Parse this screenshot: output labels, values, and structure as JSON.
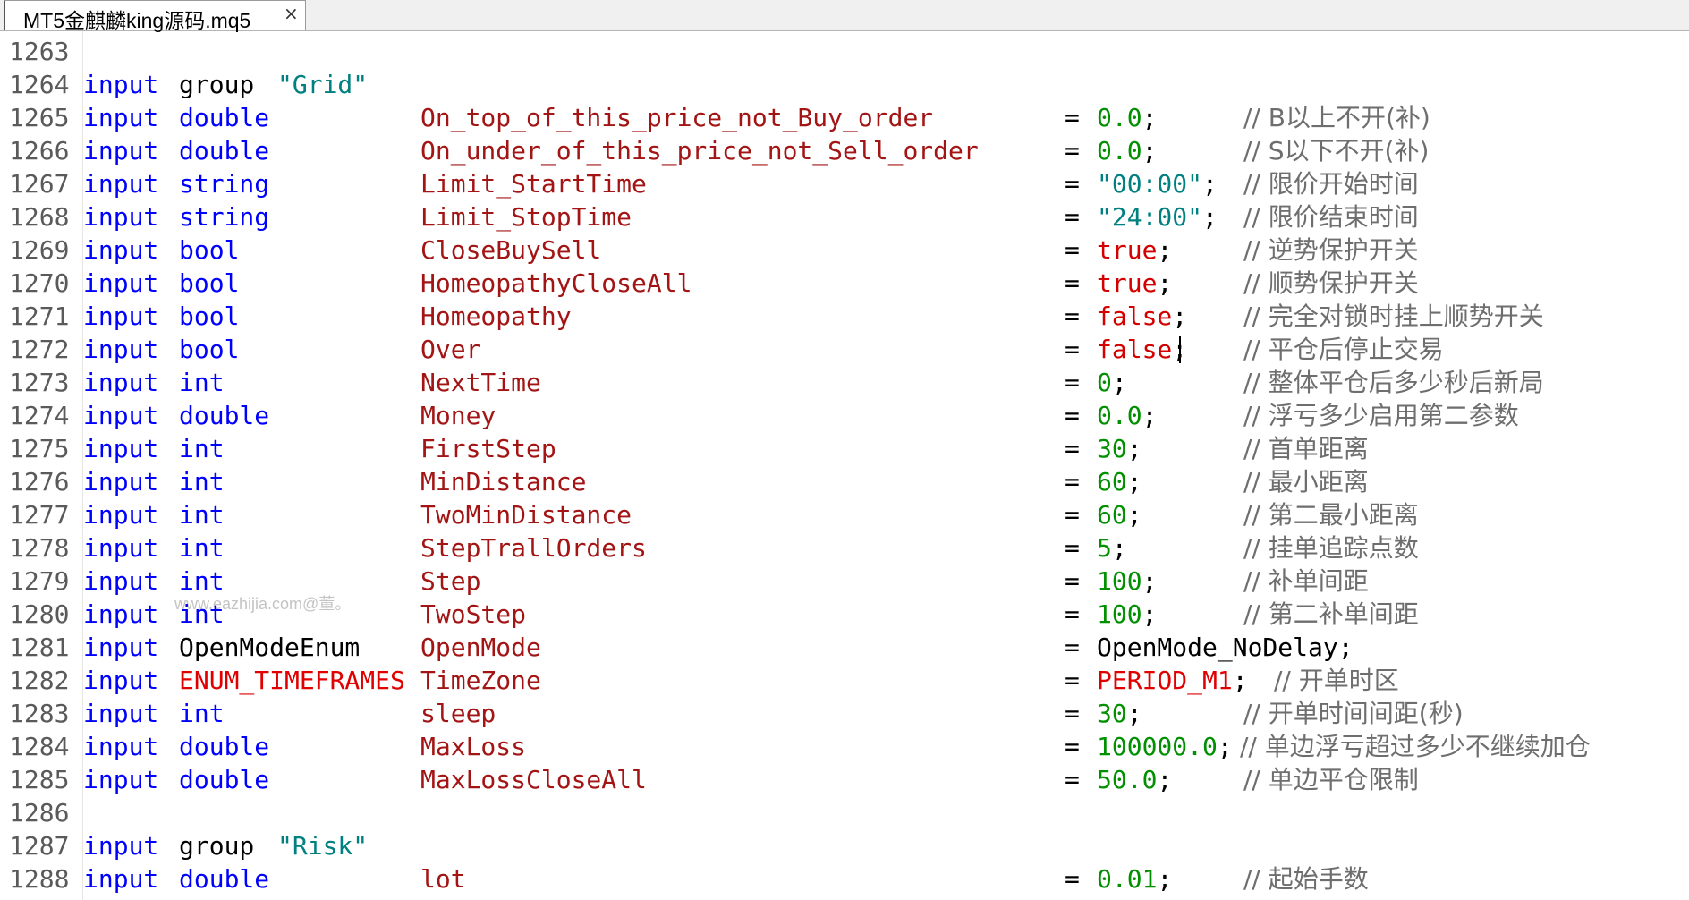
{
  "tab": {
    "title": "MT5金麒麟king源码.mq5",
    "close": "×"
  },
  "watermark": "www.eazhijia.com@董。",
  "lines": [
    {
      "num": "1263",
      "kind": "blank"
    },
    {
      "num": "1264",
      "kind": "group",
      "kw": "input",
      "word": "group",
      "str": "\"Grid\""
    },
    {
      "num": "1265",
      "kind": "param",
      "kw": "input",
      "type": "double",
      "typeColor": "blue",
      "name": "On_top_of_this_price_not_Buy_order",
      "eq": "=",
      "value": "0.0",
      "valueKind": "num",
      "semi": ";",
      "comment": "// B以上不开(补)"
    },
    {
      "num": "1266",
      "kind": "param",
      "kw": "input",
      "type": "double",
      "typeColor": "blue",
      "name": "On_under_of_this_price_not_Sell_order",
      "eq": "=",
      "value": "0.0",
      "valueKind": "num",
      "semi": ";",
      "comment": "// S以下不开(补)"
    },
    {
      "num": "1267",
      "kind": "param",
      "kw": "input",
      "type": "string",
      "typeColor": "blue",
      "name": "Limit_StartTime",
      "eq": "=",
      "value": "\"00:00\"",
      "valueKind": "str",
      "semi": ";",
      "comment": "// 限价开始时间"
    },
    {
      "num": "1268",
      "kind": "param",
      "kw": "input",
      "type": "string",
      "typeColor": "blue",
      "name": "Limit_StopTime",
      "eq": "=",
      "value": "\"24:00\"",
      "valueKind": "str",
      "semi": ";",
      "comment": "// 限价结束时间"
    },
    {
      "num": "1269",
      "kind": "param",
      "kw": "input",
      "type": "bool",
      "typeColor": "blue",
      "name": "CloseBuySell",
      "eq": "=",
      "value": "true",
      "valueKind": "bool",
      "semi": ";",
      "comment": "// 逆势保护开关"
    },
    {
      "num": "1270",
      "kind": "param",
      "kw": "input",
      "type": "bool",
      "typeColor": "blue",
      "name": "HomeopathyCloseAll",
      "eq": "=",
      "value": "true",
      "valueKind": "bool",
      "semi": ";",
      "comment": "// 顺势保护开关"
    },
    {
      "num": "1271",
      "kind": "param",
      "kw": "input",
      "type": "bool",
      "typeColor": "blue",
      "name": "Homeopathy",
      "eq": "=",
      "value": "false",
      "valueKind": "bool",
      "semi": ";",
      "comment": "// 完全对锁时挂上顺势开关"
    },
    {
      "num": "1272",
      "kind": "param",
      "kw": "input",
      "type": "bool",
      "typeColor": "blue",
      "name": "Over",
      "eq": "=",
      "value": "false",
      "valueKind": "bool",
      "semi": ";",
      "comment": "// 平仓后停止交易",
      "caret": true
    },
    {
      "num": "1273",
      "kind": "param",
      "kw": "input",
      "type": "int",
      "typeColor": "blue",
      "name": "NextTime",
      "eq": "=",
      "value": "0",
      "valueKind": "num",
      "semi": ";",
      "comment": "// 整体平仓后多少秒后新局"
    },
    {
      "num": "1274",
      "kind": "param",
      "kw": "input",
      "type": "double",
      "typeColor": "blue",
      "name": "Money",
      "eq": "=",
      "value": "0.0",
      "valueKind": "num",
      "semi": ";",
      "comment": "// 浮亏多少启用第二参数"
    },
    {
      "num": "1275",
      "kind": "param",
      "kw": "input",
      "type": "int",
      "typeColor": "blue",
      "name": "FirstStep",
      "eq": "=",
      "value": "30",
      "valueKind": "num",
      "semi": ";",
      "comment": "// 首单距离"
    },
    {
      "num": "1276",
      "kind": "param",
      "kw": "input",
      "type": "int",
      "typeColor": "blue",
      "name": "MinDistance",
      "eq": "=",
      "value": "60",
      "valueKind": "num",
      "semi": ";",
      "comment": "// 最小距离"
    },
    {
      "num": "1277",
      "kind": "param",
      "kw": "input",
      "type": "int",
      "typeColor": "blue",
      "name": "TwoMinDistance",
      "eq": "=",
      "value": "60",
      "valueKind": "num",
      "semi": ";",
      "comment": "// 第二最小距离"
    },
    {
      "num": "1278",
      "kind": "param",
      "kw": "input",
      "type": "int",
      "typeColor": "blue",
      "name": "StepTrallOrders",
      "eq": "=",
      "value": "5",
      "valueKind": "num",
      "semi": ";",
      "comment": "// 挂单追踪点数"
    },
    {
      "num": "1279",
      "kind": "param",
      "kw": "input",
      "type": "int",
      "typeColor": "blue",
      "name": "Step",
      "eq": "=",
      "value": "100",
      "valueKind": "num",
      "semi": ";",
      "comment": "// 补单间距"
    },
    {
      "num": "1280",
      "kind": "param",
      "kw": "input",
      "type": "int",
      "typeColor": "blue",
      "name": "TwoStep",
      "eq": "=",
      "value": "100",
      "valueKind": "num",
      "semi": ";",
      "comment": "// 第二补单间距"
    },
    {
      "num": "1281",
      "kind": "param",
      "kw": "input",
      "type": "OpenModeEnum",
      "typeColor": "black",
      "name": "OpenMode",
      "eq": "=",
      "value": "OpenMode_NoDelay",
      "valueKind": "ident",
      "semi": ";",
      "comment": ""
    },
    {
      "num": "1282",
      "kind": "param",
      "kw": "input",
      "type": "ENUM_TIMEFRAMES",
      "typeColor": "red",
      "name": "TimeZone",
      "eq": "=",
      "value": "PERIOD_M1",
      "valueKind": "enum",
      "semi": ";",
      "comment": "// 开单时区",
      "commentShift": true
    },
    {
      "num": "1283",
      "kind": "param",
      "kw": "input",
      "type": "int",
      "typeColor": "blue",
      "name": "sleep",
      "eq": "=",
      "value": "30",
      "valueKind": "num",
      "semi": ";",
      "comment": "// 开单时间间距(秒)"
    },
    {
      "num": "1284",
      "kind": "param",
      "kw": "input",
      "type": "double",
      "typeColor": "blue",
      "name": "MaxLoss",
      "eq": "=",
      "value": "100000.0",
      "valueKind": "num",
      "semi": ";",
      "comment": "// 单边浮亏超过多少不继续加仓",
      "commentShift": true
    },
    {
      "num": "1285",
      "kind": "param",
      "kw": "input",
      "type": "double",
      "typeColor": "blue",
      "name": "MaxLossCloseAll",
      "eq": "=",
      "value": "50.0",
      "valueKind": "num",
      "semi": ";",
      "comment": "// 单边平仓限制"
    },
    {
      "num": "1286",
      "kind": "blank"
    },
    {
      "num": "1287",
      "kind": "group",
      "kw": "input",
      "word": "group",
      "str": "\"Risk\""
    },
    {
      "num": "1288",
      "kind": "param",
      "kw": "input",
      "type": "double",
      "typeColor": "blue",
      "name": "lot",
      "eq": "=",
      "value": "0.01",
      "valueKind": "num",
      "semi": ";",
      "comment": "// 起始手数"
    }
  ]
}
